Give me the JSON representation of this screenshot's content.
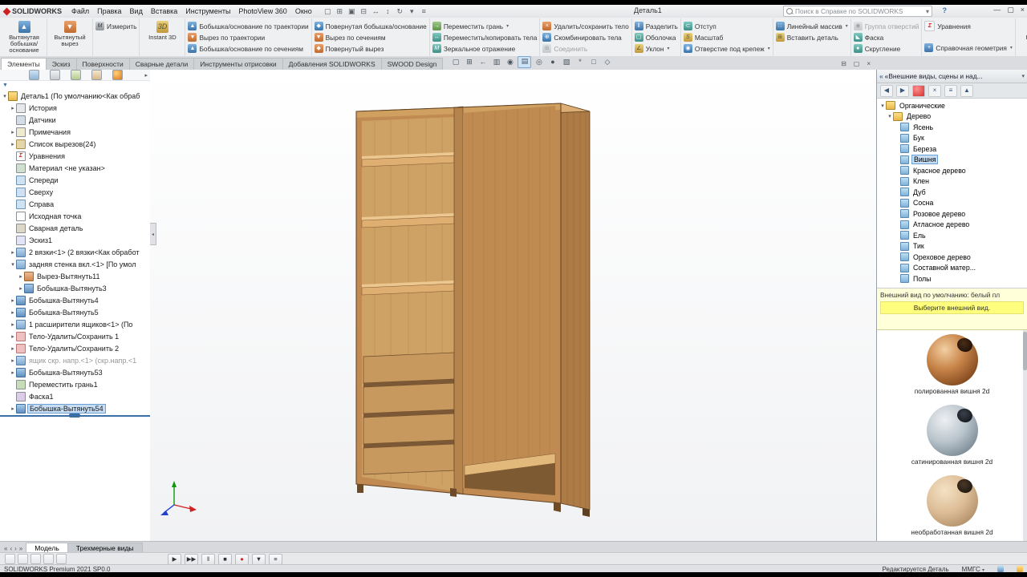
{
  "colors": {
    "brand": "#cc2222",
    "sel-bg": "#c6ddf3",
    "sel-border": "#6b9fd4",
    "warn-bg": "#ffffd9",
    "warn-hl": "#ffff7d",
    "rollback": "#3a6ea5",
    "wood": "#c08a52"
  },
  "titlebar": {
    "brand": "SOLIDWORKS",
    "menus": [
      "Файл",
      "Правка",
      "Вид",
      "Вставка",
      "Инструменты",
      "PhotoView 360",
      "Окно"
    ],
    "quick_icons": [
      {
        "name": "new-document-icon",
        "glyph": "▢"
      },
      {
        "name": "open-icon",
        "glyph": "⊞"
      },
      {
        "name": "save-icon",
        "glyph": "▣"
      },
      {
        "name": "print-icon",
        "glyph": "⊟"
      },
      {
        "name": "undo-icon",
        "glyph": "↔"
      },
      {
        "name": "redo-icon",
        "glyph": "↕"
      },
      {
        "name": "rebuild-icon",
        "glyph": "↻"
      },
      {
        "name": "select-icon",
        "glyph": "▾"
      },
      {
        "name": "options-icon",
        "glyph": "≡"
      }
    ],
    "document_title": "Деталь1",
    "search_placeholder": "Поиск в Справке по SOLIDWORKS",
    "search_dropdown_glyph": "▾",
    "help_glyph": "?",
    "window_buttons": [
      {
        "name": "minimize-button",
        "glyph": "—"
      },
      {
        "name": "maximize-button",
        "glyph": "▢"
      },
      {
        "name": "close-button",
        "glyph": "×"
      }
    ]
  },
  "ribbon": {
    "groups": [
      {
        "type": "big",
        "items": [
          {
            "icon": "extrude-boss",
            "tone": "blue",
            "glyph": "▲",
            "label": "Вытянутая бобышка/основание"
          }
        ]
      },
      {
        "type": "big",
        "items": [
          {
            "icon": "extrude-cut",
            "tone": "orange",
            "glyph": "▼",
            "label": "Вытянутый вырез"
          }
        ]
      },
      {
        "type": "stack",
        "items": [
          {
            "icon": "measure",
            "tone": "gray",
            "glyph": "M",
            "label": "Измерить"
          }
        ]
      },
      {
        "type": "big",
        "items": [
          {
            "icon": "instant3d",
            "tone": "gold",
            "glyph": "3D",
            "label": "Instant 3D"
          }
        ]
      },
      {
        "type": "stack",
        "items": [
          {
            "icon": "swept-boss",
            "tone": "blue",
            "glyph": "▲",
            "label": "Бобышка/основание по траектории"
          },
          {
            "icon": "swept-cut",
            "tone": "orange",
            "glyph": "▼",
            "label": "Вырез по траектории"
          },
          {
            "icon": "loft-boss",
            "tone": "blue",
            "glyph": "▲",
            "label": "Бобышка/основание по сечениям"
          }
        ]
      },
      {
        "type": "stack",
        "items": [
          {
            "icon": "revolve-boss",
            "tone": "blue",
            "glyph": "◆",
            "label": "Повернутая бобышка/основание"
          },
          {
            "icon": "loft-cut",
            "tone": "orange",
            "glyph": "▼",
            "label": "Вырез по сечениям"
          },
          {
            "icon": "revolve-cut",
            "tone": "orange",
            "glyph": "◆",
            "label": "Повернутый вырез"
          }
        ]
      },
      {
        "type": "stack",
        "items": [
          {
            "icon": "move-face",
            "tone": "green",
            "glyph": "→",
            "label": "Переместить грань",
            "dd": true
          },
          {
            "icon": "move-copy-body",
            "tone": "teal",
            "glyph": "↔",
            "label": "Переместить/копировать тела"
          },
          {
            "icon": "mirror",
            "tone": "teal",
            "glyph": "M",
            "label": "Зеркальное отражение"
          }
        ]
      },
      {
        "type": "stack",
        "items": [
          {
            "icon": "delete-body",
            "tone": "orange",
            "glyph": "×",
            "label": "Удалить/сохранить тело"
          },
          {
            "icon": "combine-bodies",
            "tone": "blue",
            "glyph": "⊕",
            "label": "Скомбинировать тела"
          },
          {
            "icon": "join",
            "tone": "gray",
            "glyph": "⊞",
            "label": "Соединить",
            "disabled": true
          }
        ]
      },
      {
        "type": "stack",
        "items": [
          {
            "icon": "split",
            "tone": "blue",
            "glyph": "‖",
            "label": "Разделить"
          },
          {
            "icon": "shell",
            "tone": "teal",
            "glyph": "▢",
            "label": "Оболочка"
          },
          {
            "icon": "draft",
            "tone": "gold",
            "glyph": "∠",
            "label": "Уклон",
            "dd": true
          }
        ]
      },
      {
        "type": "stack",
        "items": [
          {
            "icon": "indent",
            "tone": "teal",
            "glyph": "⊂",
            "label": "Отступ"
          },
          {
            "icon": "scale",
            "tone": "gold",
            "glyph": "S",
            "label": "Масштаб"
          },
          {
            "icon": "hole-wizard",
            "tone": "blue",
            "glyph": "◉",
            "label": "Отверстие под крепеж",
            "dd": true
          }
        ]
      },
      {
        "type": "stack",
        "items": [
          {
            "icon": "linear-pattern",
            "tone": "blue",
            "glyph": "∷",
            "label": "Линейный массив",
            "dd": true
          },
          {
            "icon": "insert-part",
            "tone": "gold",
            "glyph": "⊞",
            "label": "Вставить деталь"
          }
        ]
      },
      {
        "type": "stack",
        "items": [
          {
            "icon": "hole-series",
            "tone": "gray",
            "glyph": "◉",
            "label": "Группа отверстий",
            "disabled": true
          },
          {
            "icon": "chamfer",
            "tone": "teal",
            "glyph": "◣",
            "label": "Фаска"
          },
          {
            "icon": "fillet",
            "tone": "teal",
            "glyph": "●",
            "label": "Скругление"
          }
        ]
      },
      {
        "type": "stack",
        "items": [
          {
            "icon": "equations",
            "tone": "sigma",
            "glyph": "Σ",
            "label": "Уравнения"
          },
          {
            "icon": "reference-geometry",
            "tone": "blue",
            "glyph": "+",
            "label": "Справочная геометрия",
            "dd": true,
            "gap": true
          }
        ]
      },
      {
        "type": "big",
        "items": [
          {
            "icon": "curves",
            "tone": "blue",
            "glyph": "~",
            "label": "Кривые",
            "dd": true
          }
        ]
      }
    ]
  },
  "command_tabs": {
    "items": [
      "Элементы",
      "Эскиз",
      "Поверхности",
      "Сварные детали",
      "Инструменты отрисовки",
      "Добавления SOLIDWORKS",
      "SWOOD Design"
    ],
    "active_index": 0
  },
  "viewport": {
    "headsup_icons": [
      {
        "name": "zoom-fit-icon",
        "glyph": "▢"
      },
      {
        "name": "zoom-area-icon",
        "glyph": "⊞"
      },
      {
        "name": "previous-view-icon",
        "glyph": "←"
      },
      {
        "name": "section-view-icon",
        "glyph": "▥"
      },
      {
        "name": "dynamic-annotation-icon",
        "glyph": "◉"
      },
      {
        "name": "display-style-icon",
        "glyph": "▤",
        "active": true
      },
      {
        "name": "hide-show-items-icon",
        "glyph": "◎"
      },
      {
        "name": "edit-appearance-icon",
        "glyph": "●"
      },
      {
        "name": "apply-scene-icon",
        "glyph": "▧"
      },
      {
        "name": "view-settings-icon",
        "glyph": "*"
      },
      {
        "name": "camera-icon",
        "glyph": "□"
      },
      {
        "name": "view-orientation-icon",
        "glyph": "◇"
      }
    ],
    "window_buttons": [
      {
        "name": "doc-minimize-button",
        "glyph": "⊟"
      },
      {
        "name": "doc-restore-button",
        "glyph": "▢"
      },
      {
        "name": "doc-close-button",
        "glyph": "×"
      }
    ],
    "splitter_glyph": "◂"
  },
  "feature_panel": {
    "filter_glyph": "▼",
    "overflow_glyph": "▸",
    "tabs": [
      {
        "name": "featuremanager-tab"
      },
      {
        "name": "propertymanager-tab"
      },
      {
        "name": "configurationmanager-tab"
      },
      {
        "name": "dimxpertmanager-tab"
      },
      {
        "name": "displaymanager-tab"
      }
    ],
    "items": [
      {
        "label": "Деталь1 (По умолчанию<Как обраб",
        "lvl": 0,
        "icon": "part",
        "expanded": true
      },
      {
        "label": "История",
        "lvl": 1,
        "icon": "history",
        "arrow": true
      },
      {
        "label": "Датчики",
        "lvl": 1,
        "icon": "sensor"
      },
      {
        "label": "Примечания",
        "lvl": 1,
        "icon": "annotation",
        "arrow": true
      },
      {
        "label": "Список вырезов(24)",
        "lvl": 1,
        "icon": "cutlist",
        "arrow": true
      },
      {
        "label": "Уравнения",
        "lvl": 1,
        "icon": "equation"
      },
      {
        "label": "Материал <не указан>",
        "lvl": 1,
        "icon": "material"
      },
      {
        "label": "Спереди",
        "lvl": 1,
        "icon": "plane"
      },
      {
        "label": "Сверху",
        "lvl": 1,
        "icon": "plane"
      },
      {
        "label": "Справа",
        "lvl": 1,
        "icon": "plane"
      },
      {
        "label": "Исходная точка",
        "lvl": 1,
        "icon": "origin"
      },
      {
        "label": "Сварная деталь",
        "lvl": 1,
        "icon": "weldment"
      },
      {
        "label": "Эскиз1",
        "lvl": 1,
        "icon": "sketch"
      },
      {
        "label": "2 вязки<1> (2 вязки<Как обработ",
        "lvl": 1,
        "icon": "bodyfolder",
        "arrow": true
      },
      {
        "label": "задняя стенка вкл.<1> [По умол",
        "lvl": 1,
        "icon": "bodyfolder",
        "expanded": true
      },
      {
        "label": "Вырез-Вытянуть11",
        "lvl": 2,
        "icon": "cut",
        "arrow": true
      },
      {
        "label": "Бобышка-Вытянуть3",
        "lvl": 2,
        "icon": "boss",
        "arrow": true
      },
      {
        "label": "Бобышка-Вытянуть4",
        "lvl": 1,
        "icon": "boss",
        "arrow": true
      },
      {
        "label": "Бобышка-Вытянуть5",
        "lvl": 1,
        "icon": "boss",
        "arrow": true
      },
      {
        "label": "1 расширители ящиков<1> (По",
        "lvl": 1,
        "icon": "bodyfolder",
        "arrow": true
      },
      {
        "label": "Тело-Удалить/Сохранить 1",
        "lvl": 1,
        "icon": "delete",
        "arrow": true
      },
      {
        "label": "Тело-Удалить/Сохранить 2",
        "lvl": 1,
        "icon": "delete",
        "arrow": true
      },
      {
        "label": "ящик скр. напр.<1> (скр.напр.<1",
        "lvl": 1,
        "icon": "bodyfolder",
        "arrow": true,
        "dim": true
      },
      {
        "label": "Бобышка-Вытянуть53",
        "lvl": 1,
        "icon": "boss",
        "arrow": true
      },
      {
        "label": "Переместить грань1",
        "lvl": 1,
        "icon": "moveface"
      },
      {
        "label": "Фаска1",
        "lvl": 1,
        "icon": "chamfer"
      },
      {
        "label": "Бобышка-Вытянуть54",
        "lvl": 1,
        "icon": "boss",
        "arrow": true,
        "selected": true
      }
    ]
  },
  "task_pane": {
    "title": "«Внешние виды, сцены и над...",
    "collapse_glyph": "«",
    "pin_glyph": "▾",
    "toolbar_icons": [
      {
        "name": "back-icon",
        "glyph": "◀"
      },
      {
        "name": "forward-icon",
        "glyph": "▶"
      },
      {
        "name": "appearances-sphere-icon",
        "glyph": "●",
        "sphere": true
      },
      {
        "name": "delete-icon",
        "glyph": "×"
      },
      {
        "name": "options-icon",
        "glyph": "≡"
      },
      {
        "name": "up-level-icon",
        "glyph": "▲"
      }
    ],
    "tree": [
      {
        "label": "Органические",
        "lvl": 0,
        "icon": "folder",
        "expanded": true
      },
      {
        "label": "Дерево",
        "lvl": 1,
        "icon": "folder",
        "expanded": true
      },
      {
        "label": "Ясень",
        "lvl": 2,
        "icon": "leaf"
      },
      {
        "label": "Бук",
        "lvl": 2,
        "icon": "leaf"
      },
      {
        "label": "Береза",
        "lvl": 2,
        "icon": "leaf"
      },
      {
        "label": "Вишня",
        "lvl": 2,
        "icon": "leaf",
        "selected": true
      },
      {
        "label": "Красное дерево",
        "lvl": 2,
        "icon": "leaf"
      },
      {
        "label": "Клен",
        "lvl": 2,
        "icon": "leaf"
      },
      {
        "label": "Дуб",
        "lvl": 2,
        "icon": "leaf"
      },
      {
        "label": "Сосна",
        "lvl": 2,
        "icon": "leaf"
      },
      {
        "label": "Розовое дерево",
        "lvl": 2,
        "icon": "leaf"
      },
      {
        "label": "Атласное дерево",
        "lvl": 2,
        "icon": "leaf"
      },
      {
        "label": "Ель",
        "lvl": 2,
        "icon": "leaf"
      },
      {
        "label": "Тик",
        "lvl": 2,
        "icon": "leaf"
      },
      {
        "label": "Ореховое дерево",
        "lvl": 2,
        "icon": "leaf"
      },
      {
        "label": "Составной матер...",
        "lvl": 2,
        "icon": "leaf"
      },
      {
        "label": "Полы",
        "lvl": 2,
        "icon": "leaf"
      }
    ],
    "message_line1": "Внешний вид по умолчанию: белый пл",
    "message_line2": "Выберите внешний вид.",
    "thumbnails": [
      {
        "caption": "полированная вишня 2d",
        "style": "polished"
      },
      {
        "caption": "сатинированная вишня 2d",
        "style": "satin"
      },
      {
        "caption": "необработанная вишня 2d",
        "style": "raw"
      }
    ]
  },
  "bottom": {
    "nav_icons": [
      {
        "name": "first-tab-icon",
        "glyph": "«"
      },
      {
        "name": "prev-tab-icon",
        "glyph": "‹"
      },
      {
        "name": "next-tab-icon",
        "glyph": "›"
      },
      {
        "name": "last-tab-icon",
        "glyph": "»"
      }
    ],
    "tabs": [
      "Модель",
      "Трехмерные виды"
    ],
    "active_index": 0,
    "tray_icons": [
      {
        "name": "tray-icon-1"
      },
      {
        "name": "tray-icon-2"
      },
      {
        "name": "tray-icon-3"
      },
      {
        "name": "tray-icon-4"
      },
      {
        "name": "tray-icon-5"
      }
    ],
    "playback_icons": [
      {
        "name": "play-icon",
        "glyph": "▶"
      },
      {
        "name": "fast-forward-icon",
        "glyph": "▶▶"
      },
      {
        "name": "pause-icon",
        "glyph": "‖"
      },
      {
        "name": "stop-icon",
        "glyph": "■"
      },
      {
        "name": "record-icon",
        "glyph": "●",
        "rec": true
      },
      {
        "name": "save-animation-icon",
        "glyph": "▼"
      },
      {
        "name": "animation-options-icon",
        "glyph": "≡"
      }
    ]
  },
  "status": {
    "left": "SOLIDWORKS Premium 2021 SP0.0",
    "editing": "Редактируется Деталь",
    "units": "ММГС",
    "units_dropdown_glyph": "▾"
  }
}
